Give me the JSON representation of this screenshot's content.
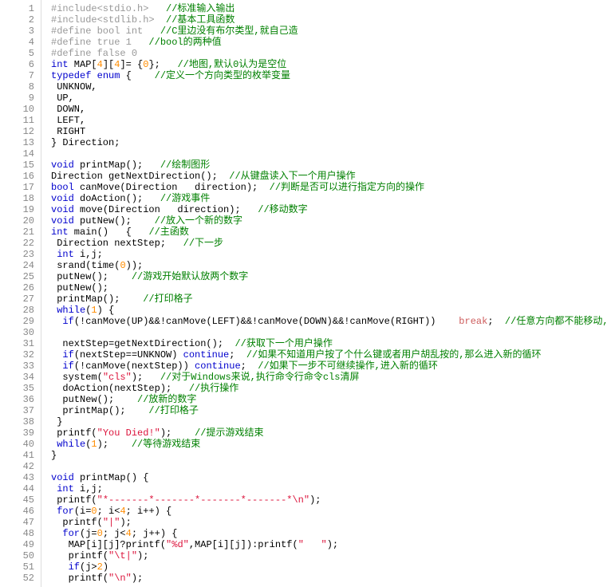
{
  "lines": [
    {
      "n": 1,
      "t": [
        [
          "pp",
          "#include<stdio.h>   "
        ],
        [
          "cm",
          "//标准输入输出"
        ]
      ]
    },
    {
      "n": 2,
      "t": [
        [
          "pp",
          "#include<stdlib.h>  "
        ],
        [
          "cm",
          "//基本工具函数"
        ]
      ]
    },
    {
      "n": 3,
      "t": [
        [
          "pp",
          "#define bool int   "
        ],
        [
          "cm",
          "//C里边没有布尔类型,就自己造"
        ]
      ]
    },
    {
      "n": 4,
      "t": [
        [
          "pp",
          "#define true 1   "
        ],
        [
          "cm",
          "//bool的两种值"
        ]
      ]
    },
    {
      "n": 5,
      "t": [
        [
          "pp",
          "#define false 0"
        ]
      ]
    },
    {
      "n": 6,
      "t": [
        [
          "kw",
          "int"
        ],
        [
          "id",
          " MAP["
        ],
        [
          "num",
          "4"
        ],
        [
          "id",
          "]["
        ],
        [
          "num",
          "4"
        ],
        [
          "id",
          "]= {"
        ],
        [
          "num",
          "0"
        ],
        [
          "id",
          "};   "
        ],
        [
          "cm",
          "//地图,默认0认为是空位"
        ]
      ]
    },
    {
      "n": 7,
      "t": [
        [
          "kw",
          "typedef"
        ],
        [
          "id",
          " "
        ],
        [
          "kw",
          "enum"
        ],
        [
          "id",
          " {    "
        ],
        [
          "cm",
          "//定义一个方向类型的枚举变量"
        ]
      ]
    },
    {
      "n": 8,
      "t": [
        [
          "id",
          " UNKNOW,"
        ]
      ]
    },
    {
      "n": 9,
      "t": [
        [
          "id",
          " UP,"
        ]
      ]
    },
    {
      "n": 10,
      "t": [
        [
          "id",
          " DOWN,"
        ]
      ]
    },
    {
      "n": 11,
      "t": [
        [
          "id",
          " LEFT,"
        ]
      ]
    },
    {
      "n": 12,
      "t": [
        [
          "id",
          " RIGHT"
        ]
      ]
    },
    {
      "n": 13,
      "t": [
        [
          "id",
          "} Direction;"
        ]
      ]
    },
    {
      "n": 14,
      "t": [
        [
          "id",
          ""
        ]
      ]
    },
    {
      "n": 15,
      "t": [
        [
          "kw",
          "void"
        ],
        [
          "id",
          " printMap();   "
        ],
        [
          "cm",
          "//绘制图形"
        ]
      ]
    },
    {
      "n": 16,
      "t": [
        [
          "id",
          "Direction getNextDirection();  "
        ],
        [
          "cm",
          "//从键盘读入下一个用户操作"
        ]
      ]
    },
    {
      "n": 17,
      "t": [
        [
          "kw",
          "bool"
        ],
        [
          "id",
          " canMove(Direction   direction);  "
        ],
        [
          "cm",
          "//判断是否可以进行指定方向的操作"
        ]
      ]
    },
    {
      "n": 18,
      "t": [
        [
          "kw",
          "void"
        ],
        [
          "id",
          " doAction();   "
        ],
        [
          "cm",
          "//游戏事件"
        ]
      ]
    },
    {
      "n": 19,
      "t": [
        [
          "kw",
          "void"
        ],
        [
          "id",
          " move(Direction   direction);   "
        ],
        [
          "cm",
          "//移动数字"
        ]
      ]
    },
    {
      "n": 20,
      "t": [
        [
          "kw",
          "void"
        ],
        [
          "id",
          " putNew();    "
        ],
        [
          "cm",
          "//放入一个新的数字"
        ]
      ]
    },
    {
      "n": 21,
      "t": [
        [
          "kw",
          "int"
        ],
        [
          "id",
          " main()   {   "
        ],
        [
          "cm",
          "//主函数"
        ]
      ]
    },
    {
      "n": 22,
      "t": [
        [
          "id",
          " Direction nextStep;   "
        ],
        [
          "cm",
          "//下一步"
        ]
      ]
    },
    {
      "n": 23,
      "t": [
        [
          "kw",
          " int"
        ],
        [
          "id",
          " i,j;"
        ]
      ]
    },
    {
      "n": 24,
      "t": [
        [
          "id",
          " "
        ],
        [
          "fn",
          "srand"
        ],
        [
          "id",
          "("
        ],
        [
          "fn",
          "time"
        ],
        [
          "id",
          "("
        ],
        [
          "num",
          "0"
        ],
        [
          "id",
          "));"
        ]
      ]
    },
    {
      "n": 25,
      "t": [
        [
          "id",
          " putNew();    "
        ],
        [
          "cm",
          "//游戏开始默认放两个数字"
        ]
      ]
    },
    {
      "n": 26,
      "t": [
        [
          "id",
          " putNew();"
        ]
      ]
    },
    {
      "n": 27,
      "t": [
        [
          "id",
          " printMap();    "
        ],
        [
          "cm",
          "//打印格子"
        ]
      ]
    },
    {
      "n": 28,
      "t": [
        [
          "id",
          " "
        ],
        [
          "kw",
          "while"
        ],
        [
          "id",
          "("
        ],
        [
          "num",
          "1"
        ],
        [
          "id",
          ") {"
        ]
      ]
    },
    {
      "n": 29,
      "t": [
        [
          "id",
          "  "
        ],
        [
          "kw",
          "if"
        ],
        [
          "id",
          "(!canMove(UP)&&!canMove(LEFT)&&!canMove(DOWN)&&!canMove(RIGHT))    "
        ],
        [
          "ctl",
          "break"
        ],
        [
          "id",
          ";  "
        ],
        [
          "cm",
          "//任意方向都不能移动,那么终止游戏"
        ]
      ]
    },
    {
      "n": 30,
      "t": [
        [
          "id",
          ""
        ]
      ]
    },
    {
      "n": 31,
      "t": [
        [
          "id",
          "  nextStep=getNextDirection();  "
        ],
        [
          "cm",
          "//获取下一个用户操作"
        ]
      ]
    },
    {
      "n": 32,
      "t": [
        [
          "id",
          "  "
        ],
        [
          "kw",
          "if"
        ],
        [
          "id",
          "(nextStep==UNKNOW) "
        ],
        [
          "kw",
          "continue"
        ],
        [
          "id",
          ";  "
        ],
        [
          "cm",
          "//如果不知道用户按了个什么键或者用户胡乱按的,那么进入新的循环"
        ]
      ]
    },
    {
      "n": 33,
      "t": [
        [
          "id",
          "  "
        ],
        [
          "kw",
          "if"
        ],
        [
          "id",
          "(!canMove(nextStep)) "
        ],
        [
          "kw",
          "continue"
        ],
        [
          "id",
          ";  "
        ],
        [
          "cm",
          "//如果下一步不可继续操作,进入新的循环"
        ]
      ]
    },
    {
      "n": 34,
      "t": [
        [
          "id",
          "  "
        ],
        [
          "fn",
          "system"
        ],
        [
          "id",
          "("
        ],
        [
          "str",
          "\"cls\""
        ],
        [
          "id",
          ");   "
        ],
        [
          "cm",
          "//对于Windows来说,执行命令行命令cls清屏"
        ]
      ]
    },
    {
      "n": 35,
      "t": [
        [
          "id",
          "  doAction(nextStep);   "
        ],
        [
          "cm",
          "//执行操作"
        ]
      ]
    },
    {
      "n": 36,
      "t": [
        [
          "id",
          "  putNew();    "
        ],
        [
          "cm",
          "//放新的数字"
        ]
      ]
    },
    {
      "n": 37,
      "t": [
        [
          "id",
          "  printMap();    "
        ],
        [
          "cm",
          "//打印格子"
        ]
      ]
    },
    {
      "n": 38,
      "t": [
        [
          "id",
          " }"
        ]
      ]
    },
    {
      "n": 39,
      "t": [
        [
          "id",
          " "
        ],
        [
          "fn",
          "printf"
        ],
        [
          "id",
          "("
        ],
        [
          "str",
          "\"You Died!\""
        ],
        [
          "id",
          ");    "
        ],
        [
          "cm",
          "//提示游戏结束"
        ]
      ]
    },
    {
      "n": 40,
      "t": [
        [
          "id",
          " "
        ],
        [
          "kw",
          "while"
        ],
        [
          "id",
          "("
        ],
        [
          "num",
          "1"
        ],
        [
          "id",
          ");    "
        ],
        [
          "cm",
          "//等待游戏结束"
        ]
      ]
    },
    {
      "n": 41,
      "t": [
        [
          "id",
          "}"
        ]
      ]
    },
    {
      "n": 42,
      "t": [
        [
          "id",
          ""
        ]
      ]
    },
    {
      "n": 43,
      "t": [
        [
          "kw",
          "void"
        ],
        [
          "id",
          " printMap() {"
        ]
      ]
    },
    {
      "n": 44,
      "t": [
        [
          "kw",
          " int"
        ],
        [
          "id",
          " i,j;"
        ]
      ]
    },
    {
      "n": 45,
      "t": [
        [
          "id",
          " "
        ],
        [
          "fn",
          "printf"
        ],
        [
          "id",
          "("
        ],
        [
          "str",
          "\"*-------*-------*-------*-------*\\n\""
        ],
        [
          "id",
          ");"
        ]
      ]
    },
    {
      "n": 46,
      "t": [
        [
          "id",
          " "
        ],
        [
          "kw",
          "for"
        ],
        [
          "id",
          "(i="
        ],
        [
          "num",
          "0"
        ],
        [
          "id",
          "; i<"
        ],
        [
          "num",
          "4"
        ],
        [
          "id",
          "; i++) {"
        ]
      ]
    },
    {
      "n": 47,
      "t": [
        [
          "id",
          "  "
        ],
        [
          "fn",
          "printf"
        ],
        [
          "id",
          "("
        ],
        [
          "str",
          "\"|\""
        ],
        [
          "id",
          ");"
        ]
      ]
    },
    {
      "n": 48,
      "t": [
        [
          "id",
          "  "
        ],
        [
          "kw",
          "for"
        ],
        [
          "id",
          "(j="
        ],
        [
          "num",
          "0"
        ],
        [
          "id",
          "; j<"
        ],
        [
          "num",
          "4"
        ],
        [
          "id",
          "; j++) {"
        ]
      ]
    },
    {
      "n": 49,
      "t": [
        [
          "id",
          "   MAP[i][j]?"
        ],
        [
          "fn",
          "printf"
        ],
        [
          "id",
          "("
        ],
        [
          "str",
          "\"%d\""
        ],
        [
          "id",
          ",MAP[i][j]):"
        ],
        [
          "fn",
          "printf"
        ],
        [
          "id",
          "("
        ],
        [
          "str",
          "\"   \""
        ],
        [
          "id",
          ");"
        ]
      ]
    },
    {
      "n": 50,
      "t": [
        [
          "id",
          "   "
        ],
        [
          "fn",
          "printf"
        ],
        [
          "id",
          "("
        ],
        [
          "str",
          "\"\\t|\""
        ],
        [
          "id",
          ");"
        ]
      ]
    },
    {
      "n": 51,
      "t": [
        [
          "id",
          "   "
        ],
        [
          "kw",
          "if"
        ],
        [
          "id",
          "(j>"
        ],
        [
          "num",
          "2"
        ],
        [
          "id",
          ")"
        ]
      ]
    },
    {
      "n": 52,
      "t": [
        [
          "id",
          "   "
        ],
        [
          "fn",
          "printf"
        ],
        [
          "id",
          "("
        ],
        [
          "str",
          "\"\\n\""
        ],
        [
          "id",
          ");"
        ]
      ]
    }
  ]
}
